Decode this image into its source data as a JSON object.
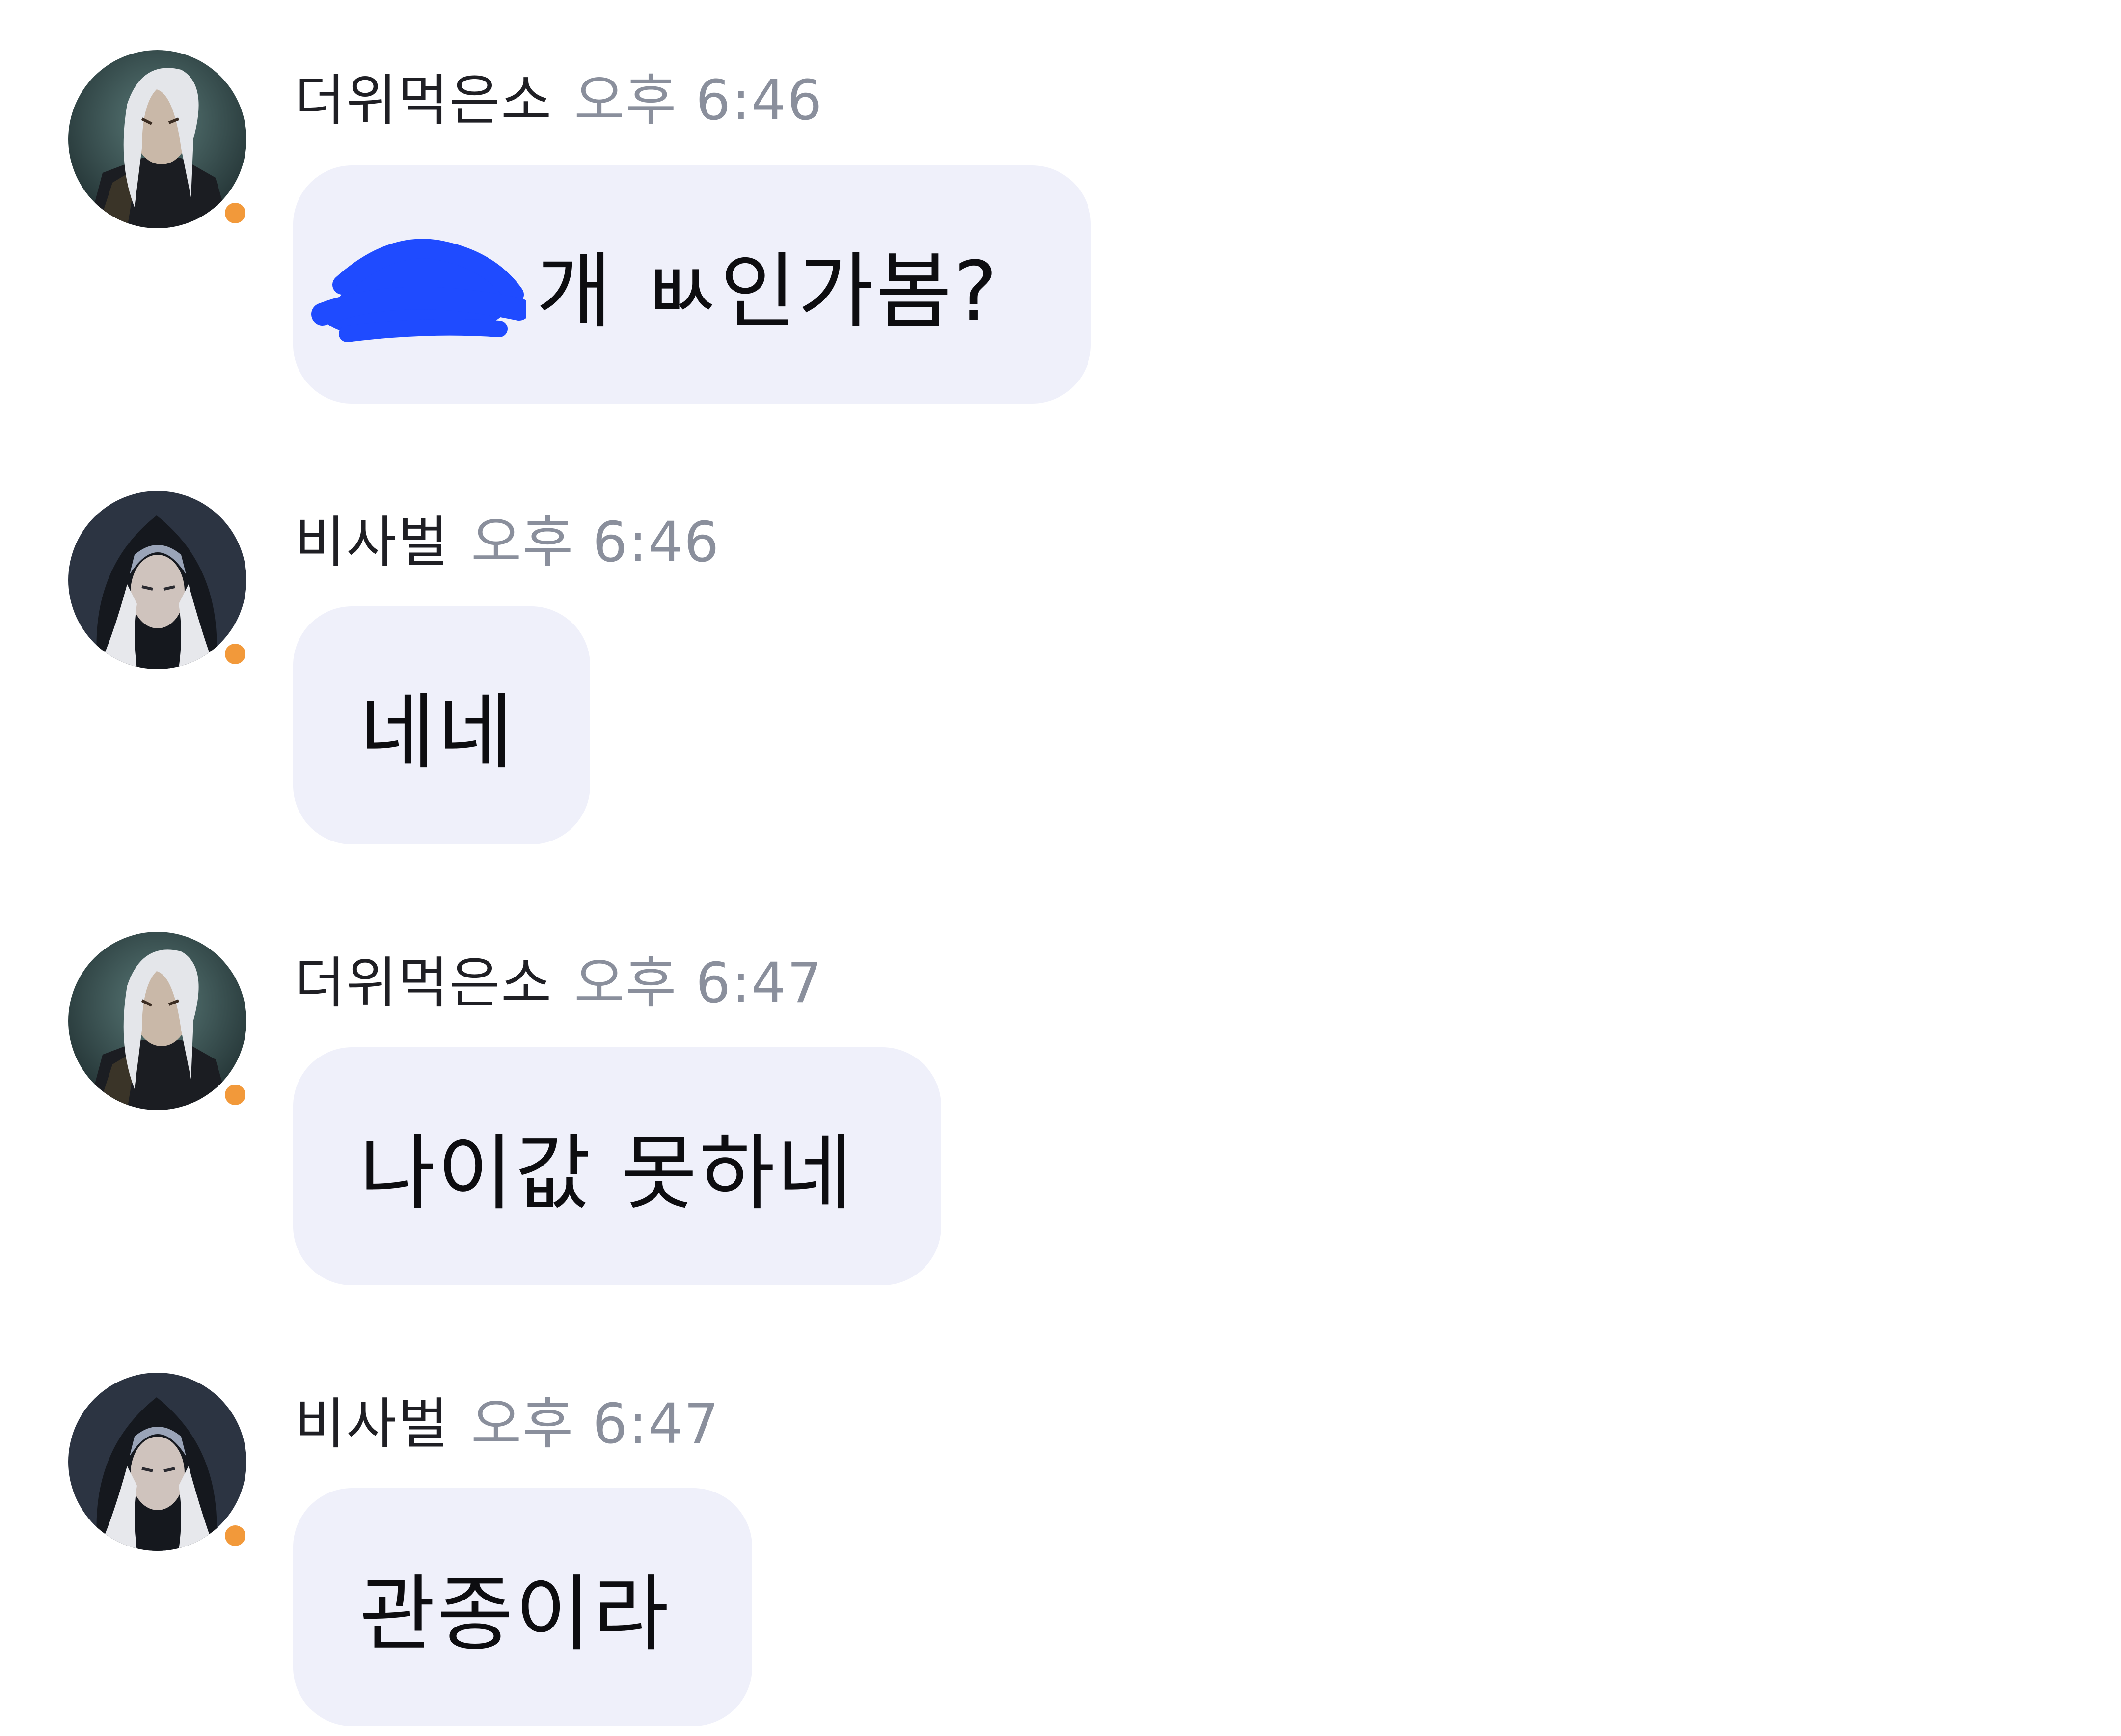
{
  "messages": [
    {
      "username": "더위먹은소",
      "time": "오후 6:46",
      "text": "개 ㅄ인가봄?",
      "redacted_prefix": true,
      "avatar_icon": "white-haired-warrior-avatar"
    },
    {
      "username": "비사벌",
      "time": "오후 6:46",
      "text": "네네",
      "redacted_prefix": false,
      "avatar_icon": "hooded-elf-avatar"
    },
    {
      "username": "더위먹은소",
      "time": "오후 6:47",
      "text": "나이값 못하네",
      "redacted_prefix": false,
      "avatar_icon": "white-haired-warrior-avatar"
    },
    {
      "username": "비사벌",
      "time": "오후 6:47",
      "text": "관종이라",
      "redacted_prefix": false,
      "avatar_icon": "hooded-elf-avatar"
    }
  ],
  "colors": {
    "bubble": "#EFF0FA",
    "status_dot": "#F2993A",
    "timestamp": "#8A8F9C",
    "redaction": "#1F4BFF"
  }
}
